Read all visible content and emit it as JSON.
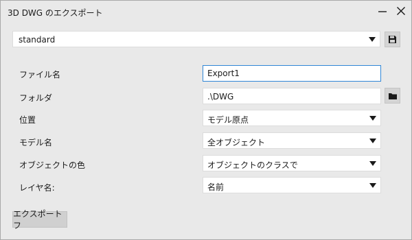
{
  "window": {
    "title": "3D DWG のエクスポート"
  },
  "preset": {
    "value": "standard"
  },
  "form": {
    "file_name": {
      "label": "ファイル名",
      "value": "Export1"
    },
    "folder": {
      "label": "フォルダ",
      "value": ".\\DWG"
    },
    "position": {
      "label": "位置",
      "value": "モデル原点"
    },
    "model_name": {
      "label": "モデル名",
      "value": "全オブジェクト"
    },
    "object_color": {
      "label": "オブジェクトの色",
      "value": "オブジェクトのクラスで"
    },
    "layer_name": {
      "label": "レイヤ名:",
      "value": "名前"
    }
  },
  "actions": {
    "export_label": "エクスポートフ"
  },
  "icons": {
    "minimize": "minimize-icon",
    "close": "close-icon",
    "save": "save-icon",
    "folder": "folder-icon",
    "dropdown": "chevron-down-icon"
  },
  "colors": {
    "focus_border": "#2f86d6",
    "background": "#e9e9e9",
    "button": "#d0d0d0"
  }
}
